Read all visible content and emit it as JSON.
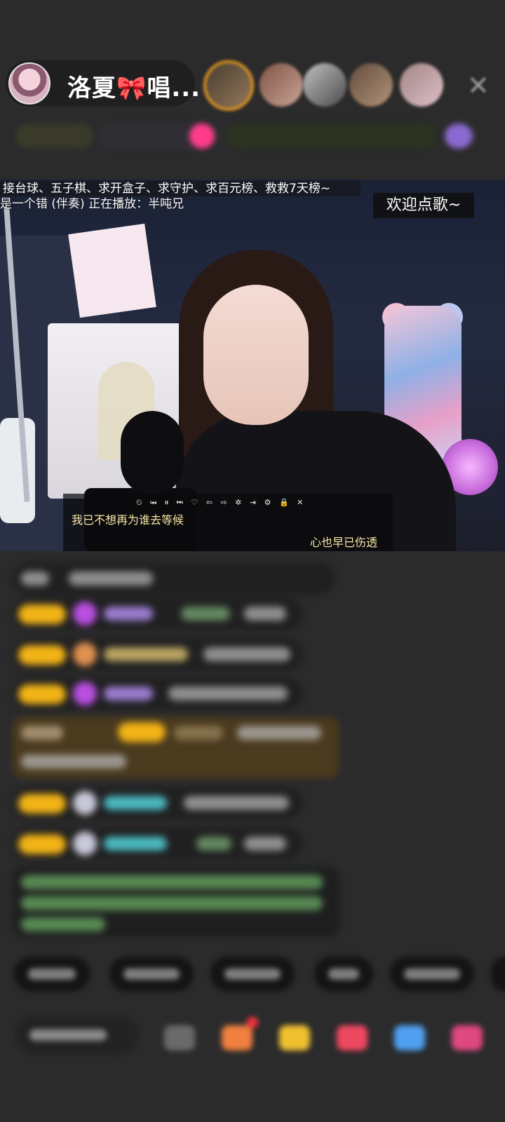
{
  "header": {
    "streamer_name": "洛夏🎀唱...",
    "close_icon": "close-icon"
  },
  "video": {
    "marquee_text": "接台球、五子棋、求开盒子、求守护、求百元榜、救救7天榜~",
    "now_playing_text": "是一个错 (伴奏) 正在播放：半吨兄",
    "welcome_badge": "欢迎点歌~",
    "player_controls": "⏲ ⏮ ⏸ ⏭ ♡ ⇦ ⇨ ✲ ⇥ ⚙ 🔒 ✕",
    "lyric_line_1": "我已不想再为谁去等候",
    "lyric_line_2": "心也早已伤透"
  },
  "colors": {
    "background": "#2b2b2c",
    "level_badge": "#f2b316",
    "lyrics": "#f6e7a8",
    "accent_pink": "#ff3d8a",
    "accent_green": "#c7e06a"
  }
}
